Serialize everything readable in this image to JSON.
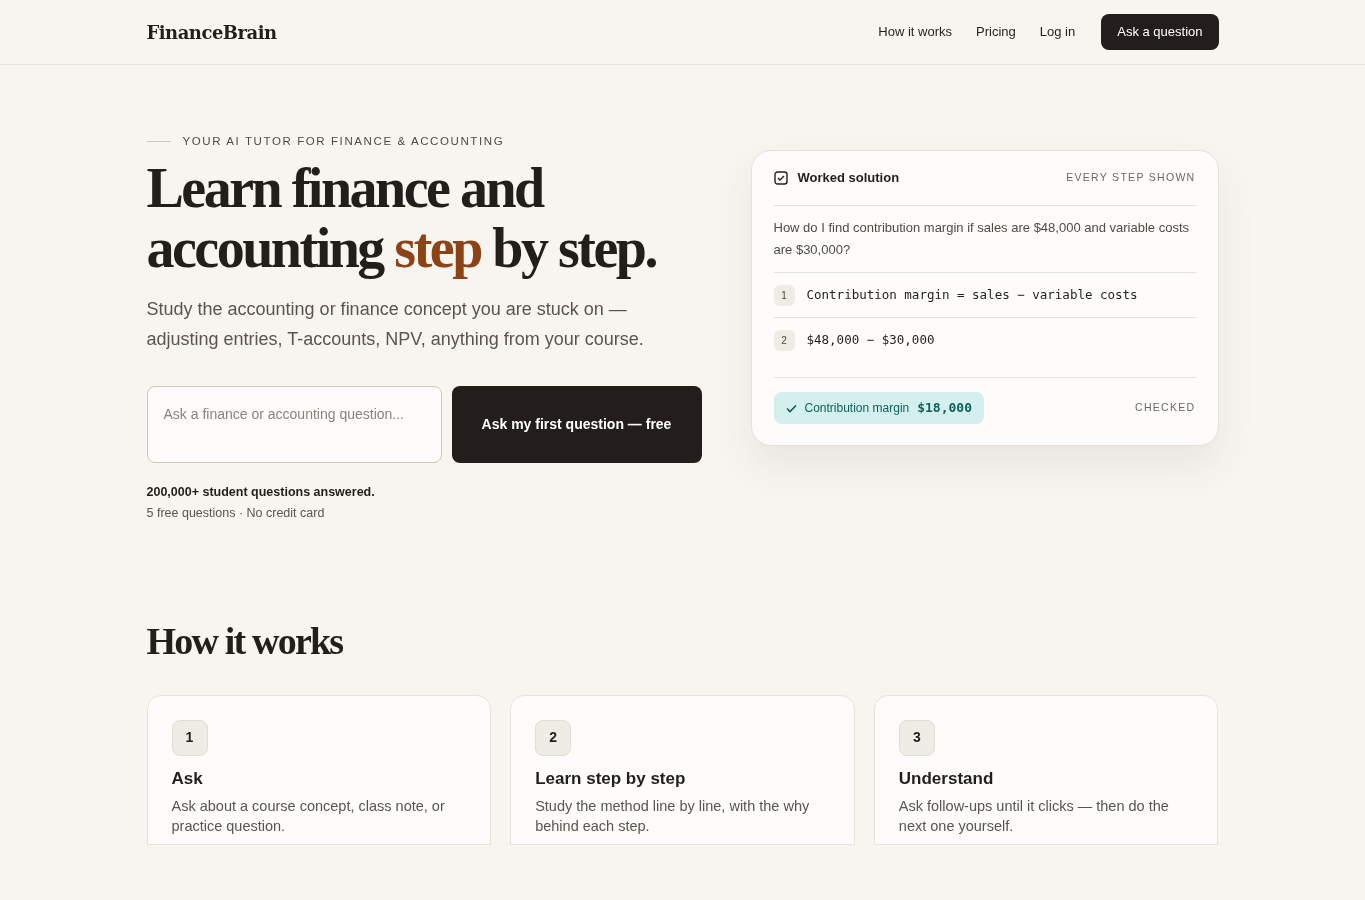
{
  "nav": {
    "logo": "FinanceBrain",
    "links": [
      "How it works",
      "Pricing",
      "Log in"
    ],
    "cta": "Ask a question"
  },
  "hero": {
    "eyebrow": "YOUR AI TUTOR FOR FINANCE & ACCOUNTING",
    "headline_before": "Learn finance and accounting",
    "headline_accent": "step",
    "headline_after": "by step.",
    "subtitle": "Study the accounting or finance concept you are stuck on — adjusting entries, T-accounts, NPV, anything from your course.",
    "search": {
      "placeholder": "Ask a finance or accounting question..."
    },
    "button": "Ask my first question — free",
    "proof": "200,000+ student questions answered.",
    "note": "5 free questions · No credit card"
  },
  "solution_card": {
    "title": "Worked solution",
    "tag": "EVERY STEP SHOWN",
    "question": "How do I find contribution margin if sales are $48,000 and variable costs are $30,000?",
    "steps": [
      {
        "number": "1",
        "formula": "Contribution margin = sales − variable costs"
      },
      {
        "number": "2",
        "formula": "$48,000 − $30,000"
      }
    ],
    "result": {
      "label": "Contribution margin",
      "value": "$18,000"
    },
    "status": "CHECKED"
  },
  "how_it_works": {
    "title": "How it works",
    "cards": [
      {
        "number": "1",
        "title": "Ask",
        "text": "Ask about a course concept, class note, or practice question."
      },
      {
        "number": "2",
        "title": "Learn step by step",
        "text": "Study the method line by line, with the why behind each step."
      },
      {
        "number": "3",
        "title": "Understand",
        "text": "Ask follow-ups until it clicks — then do the next one yourself."
      }
    ]
  }
}
